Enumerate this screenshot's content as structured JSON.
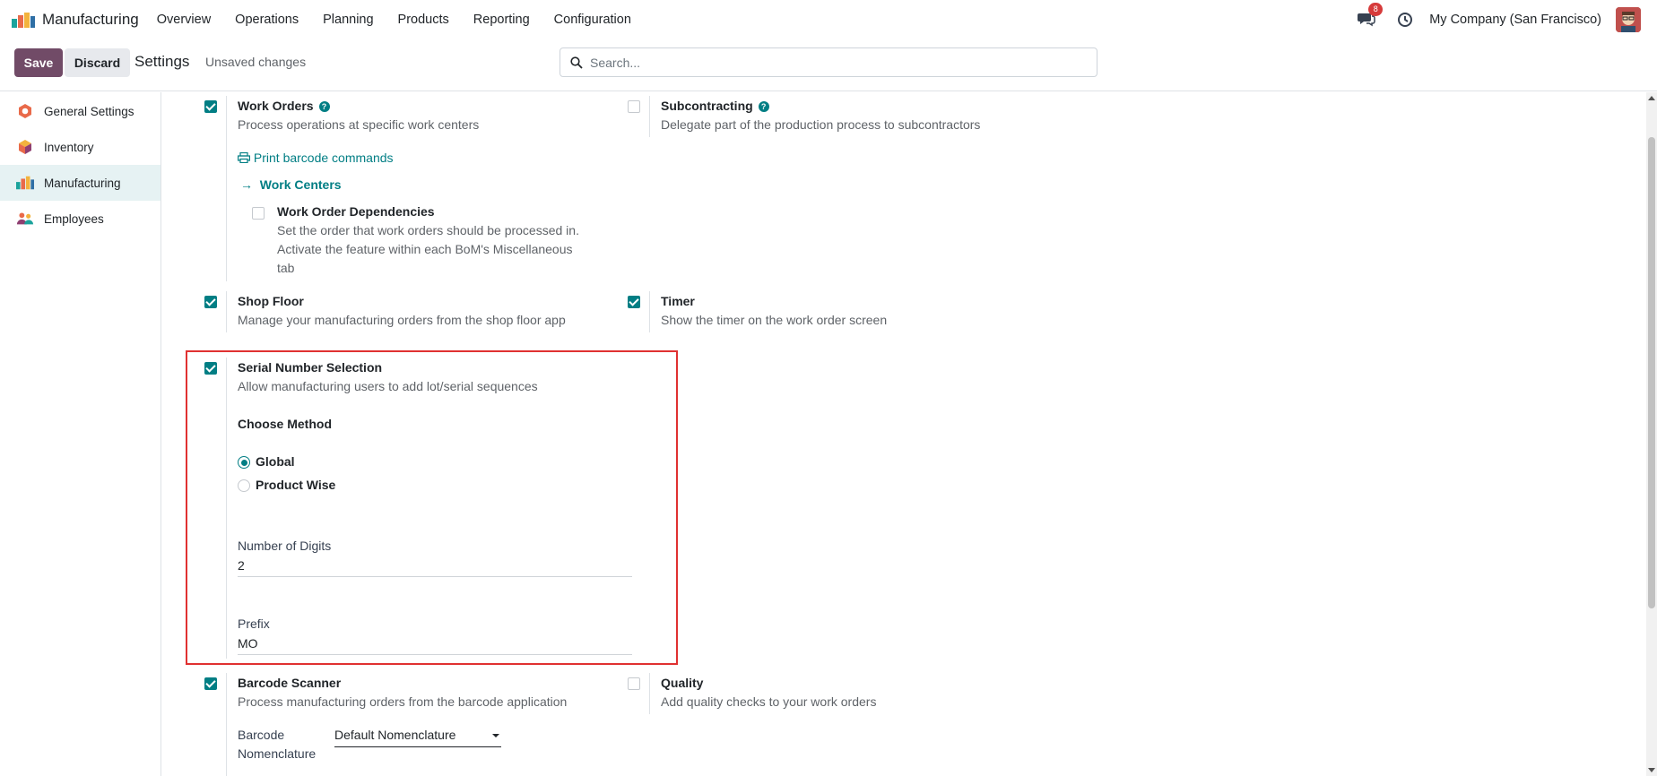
{
  "navbar": {
    "app_name": "Manufacturing",
    "menu": [
      "Overview",
      "Operations",
      "Planning",
      "Products",
      "Reporting",
      "Configuration"
    ],
    "notification_count": "8",
    "company": "My Company (San Francisco)"
  },
  "control_panel": {
    "save_label": "Save",
    "discard_label": "Discard",
    "title": "Settings",
    "status": "Unsaved changes",
    "search_placeholder": "Search..."
  },
  "sidebar": {
    "items": [
      {
        "label": "General Settings",
        "icon": "general-settings-icon",
        "active": false
      },
      {
        "label": "Inventory",
        "icon": "inventory-icon",
        "active": false
      },
      {
        "label": "Manufacturing",
        "icon": "manufacturing-icon",
        "active": true
      },
      {
        "label": "Employees",
        "icon": "employees-icon",
        "active": false
      }
    ]
  },
  "settings": {
    "work_orders": {
      "title": "Work Orders",
      "desc": "Process operations at specific work centers",
      "checked": true,
      "print_link": "Print barcode commands",
      "work_centers_link": "Work Centers",
      "dependencies": {
        "title": "Work Order Dependencies",
        "desc_lines": [
          "Set the order that work orders should be processed in.",
          "Activate the feature within each BoM's Miscellaneous",
          "tab"
        ],
        "checked": false
      }
    },
    "subcontracting": {
      "title": "Subcontracting",
      "desc": "Delegate part of the production process to subcontractors",
      "checked": false
    },
    "shop_floor": {
      "title": "Shop Floor",
      "desc": "Manage your manufacturing orders from the shop floor app",
      "checked": true
    },
    "timer": {
      "title": "Timer",
      "desc": "Show the timer on the work order screen",
      "checked": true
    },
    "serial_number": {
      "title": "Serial Number Selection",
      "desc": "Allow manufacturing users to add lot/serial sequences",
      "checked": true,
      "method_label": "Choose Method",
      "options": [
        {
          "label": "Global",
          "selected": true
        },
        {
          "label": "Product Wise",
          "selected": false
        }
      ],
      "digits_label": "Number of Digits",
      "digits_value": "2",
      "prefix_label": "Prefix",
      "prefix_value": "MO"
    },
    "barcode": {
      "title": "Barcode Scanner",
      "desc": "Process manufacturing orders from the barcode application",
      "checked": true,
      "nomenclature_label_1": "Barcode",
      "nomenclature_label_2": "Nomenclature",
      "nomenclature_value": "Default Nomenclature"
    },
    "quality": {
      "title": "Quality",
      "desc": "Add quality checks to your work orders",
      "checked": false
    }
  },
  "colors": {
    "brand": "#714b67",
    "accent": "#017e84",
    "highlight": "#e03131"
  }
}
